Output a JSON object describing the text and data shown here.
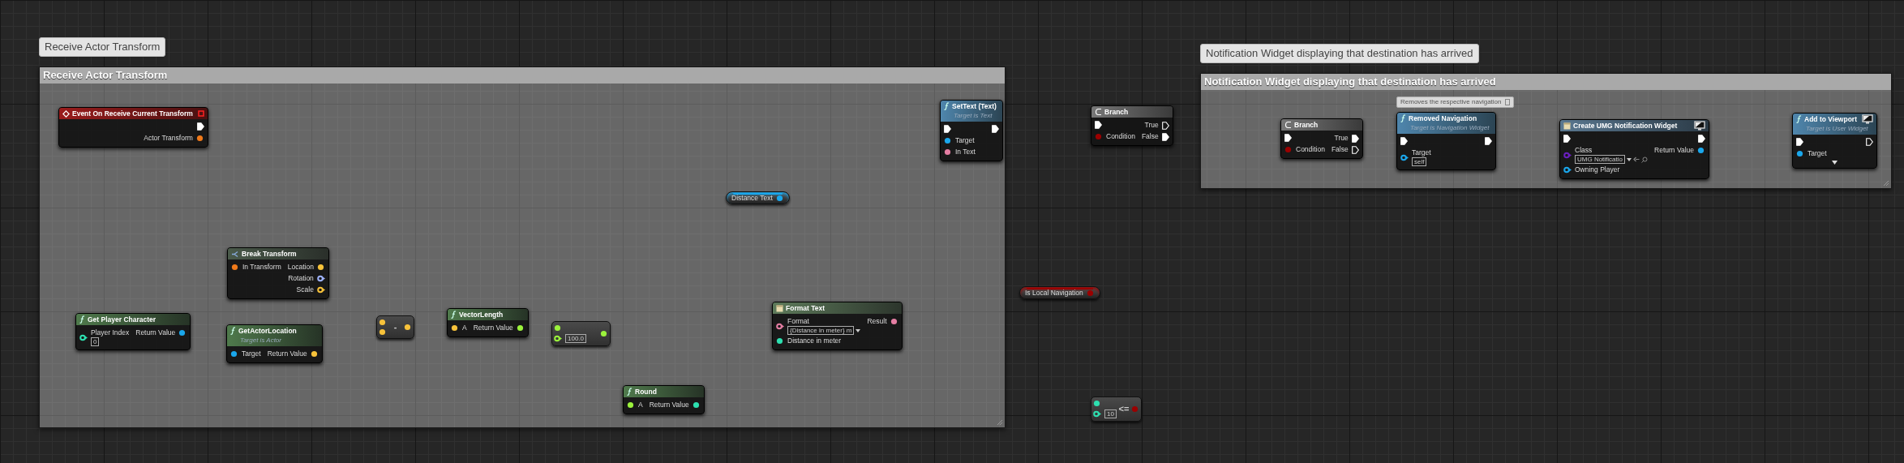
{
  "comments": [
    {
      "bubble": "Receive Actor Transform",
      "title": "Receive Actor Transform"
    },
    {
      "bubble": "Notification Widget displaying that destination has arrived",
      "title": "Notification Widget displaying that destination has arrived"
    }
  ],
  "nodes": [
    {
      "kind": "event",
      "title": "Event On Receive Current Transform",
      "delegate": true,
      "rows": [
        {
          "out": {
            "kind": "exec",
            "connected": true
          }
        },
        {
          "out": {
            "kind": "data",
            "label": "Actor Transform",
            "color": "#f07a1a",
            "connected": true
          }
        }
      ]
    },
    {
      "kind": "struct",
      "title": "Break Transform",
      "rows": [
        {
          "in": {
            "kind": "data",
            "label": "In Transform",
            "color": "#f07a1a",
            "connected": true
          },
          "out": {
            "kind": "data",
            "label": "Location",
            "color": "#f7c23a",
            "connected": true
          }
        },
        {
          "out": {
            "kind": "data",
            "label": "Rotation",
            "color": "#9fb3ff",
            "connected": false
          }
        },
        {
          "out": {
            "kind": "data",
            "label": "Scale",
            "color": "#f7c23a",
            "connected": false
          }
        }
      ]
    },
    {
      "kind": "function",
      "title": "Get Player Character",
      "rows": [
        {
          "in": {
            "kind": "data",
            "label": "Player Index",
            "color": "#2de0b0",
            "connected": false,
            "default": "0"
          },
          "out": {
            "kind": "data",
            "label": "Return Value",
            "color": "#1aa7ec",
            "connected": true
          }
        }
      ]
    },
    {
      "kind": "function",
      "title": "GetActorLocation",
      "subtitle": "Target is Actor",
      "rows": [
        {
          "in": {
            "kind": "data",
            "label": "Target",
            "color": "#1aa7ec",
            "connected": true
          },
          "out": {
            "kind": "data",
            "label": "Return Value",
            "color": "#f7c23a",
            "connected": true
          }
        }
      ]
    },
    {
      "kind": "operator",
      "symbol": "-",
      "rows": [
        {
          "in": {
            "kind": "data",
            "color": "#f7c23a",
            "connected": true
          },
          "out": {
            "kind": "data",
            "color": "#f7c23a",
            "connected": true
          }
        },
        {
          "in": {
            "kind": "data",
            "color": "#f7c23a",
            "connected": true
          }
        }
      ]
    },
    {
      "kind": "function",
      "title": "VectorLength",
      "rows": [
        {
          "in": {
            "kind": "data",
            "label": "A",
            "color": "#f7c23a",
            "connected": true
          },
          "out": {
            "kind": "data",
            "label": "Return Value",
            "color": "#9bf23c",
            "connected": true
          }
        }
      ]
    },
    {
      "kind": "operator",
      "rows": [
        {
          "in": {
            "kind": "data",
            "color": "#9bf23c",
            "connected": true
          },
          "out": {
            "kind": "data",
            "color": "#9bf23c",
            "connected": true
          }
        },
        {
          "in": {
            "kind": "data",
            "color": "#9bf23c",
            "connected": false,
            "default": "100.0"
          }
        }
      ]
    },
    {
      "kind": "function",
      "title": "Round",
      "rows": [
        {
          "in": {
            "kind": "data",
            "label": "A",
            "color": "#9bf23c",
            "connected": true
          },
          "out": {
            "kind": "data",
            "label": "Return Value",
            "color": "#2de0b0",
            "connected": true
          }
        }
      ]
    },
    {
      "kind": "variable",
      "title": "Distance Text",
      "color": "#1aa7ec",
      "rows": [
        {
          "out": {
            "kind": "data",
            "color": "#1aa7ec",
            "connected": true
          }
        }
      ]
    },
    {
      "kind": "text",
      "title": "Format Text",
      "rows": [
        {
          "in": {
            "kind": "text",
            "label": "Format",
            "color": "#e57ea3",
            "connected": false,
            "default": "{Distance in meter} m"
          },
          "out": {
            "kind": "data",
            "label": "Result",
            "color": "#e57ea3",
            "connected": true
          }
        },
        {
          "in": {
            "kind": "data",
            "label": "Distance in meter",
            "color": "#2de0b0",
            "connected": true
          }
        }
      ]
    },
    {
      "kind": "call",
      "title": "SetText (Text)",
      "subtitle": "Target is Text",
      "rows": [
        {
          "in": {
            "kind": "exec",
            "connected": true
          },
          "out": {
            "kind": "exec",
            "connected": true
          }
        },
        {
          "in": {
            "kind": "data",
            "label": "Target",
            "color": "#1aa7ec",
            "connected": true
          }
        },
        {
          "in": {
            "kind": "data",
            "label": "In Text",
            "color": "#e57ea3",
            "connected": true
          }
        }
      ]
    },
    {
      "kind": "branch",
      "title": "Branch",
      "rows": [
        {
          "in": {
            "kind": "exec",
            "connected": true
          },
          "out": {
            "kind": "exec",
            "label": "True",
            "connected": false
          }
        },
        {
          "in": {
            "kind": "data",
            "label": "Condition",
            "color": "#9b0000",
            "connected": true
          },
          "out": {
            "kind": "exec",
            "label": "False",
            "connected": true
          }
        }
      ]
    },
    {
      "kind": "variable",
      "title": "Is Local Navigation",
      "color": "#9b0000",
      "rows": [
        {
          "out": {
            "kind": "data",
            "color": "#9b0000",
            "connected": true
          }
        }
      ]
    },
    {
      "kind": "operator",
      "symbol": "<=",
      "rows": [
        {
          "in": {
            "kind": "data",
            "color": "#2de0b0",
            "connected": true
          },
          "out": {
            "kind": "data",
            "color": "#9b0000",
            "connected": true
          }
        },
        {
          "in": {
            "kind": "data",
            "color": "#2de0b0",
            "connected": false,
            "default": "10"
          }
        }
      ]
    },
    {
      "kind": "branch",
      "title": "Branch",
      "rows": [
        {
          "in": {
            "kind": "exec",
            "connected": true
          },
          "out": {
            "kind": "exec",
            "label": "True",
            "connected": true
          }
        },
        {
          "in": {
            "kind": "data",
            "label": "Condition",
            "color": "#9b0000",
            "connected": true
          },
          "out": {
            "kind": "exec",
            "label": "False",
            "connected": false
          }
        }
      ]
    },
    {
      "kind": "call",
      "title": "Removed Navigation",
      "subtitle": "Target is Navigation Widget",
      "tooltip": "Removes the respective navigation",
      "rows": [
        {
          "in": {
            "kind": "exec",
            "connected": true
          },
          "out": {
            "kind": "exec",
            "connected": true
          }
        },
        {
          "in": {
            "kind": "data",
            "label": "Target",
            "color": "#1aa7ec",
            "connected": false,
            "default": "self"
          }
        }
      ]
    },
    {
      "kind": "widget",
      "title": "Create UMG Notification Widget",
      "client_only": true,
      "rows": [
        {
          "in": {
            "kind": "exec",
            "connected": true
          },
          "out": {
            "kind": "exec",
            "connected": true
          }
        },
        {
          "in": {
            "kind": "class",
            "label": "Class",
            "color": "#6a1fc0",
            "connected": false,
            "default": "UMG Notificatio"
          },
          "out": {
            "kind": "data",
            "label": "Return Value",
            "color": "#1aa7ec",
            "connected": true
          }
        },
        {
          "in": {
            "kind": "data",
            "label": "Owning Player",
            "color": "#1aa7ec",
            "connected": false
          }
        }
      ]
    },
    {
      "kind": "call",
      "title": "Add to Viewport",
      "subtitle": "Target is User Widget",
      "client_only": true,
      "expandable": true,
      "rows": [
        {
          "in": {
            "kind": "exec",
            "connected": true
          },
          "out": {
            "kind": "exec",
            "connected": false
          }
        },
        {
          "in": {
            "kind": "data",
            "label": "Target",
            "color": "#1aa7ec",
            "connected": true
          }
        }
      ]
    }
  ]
}
